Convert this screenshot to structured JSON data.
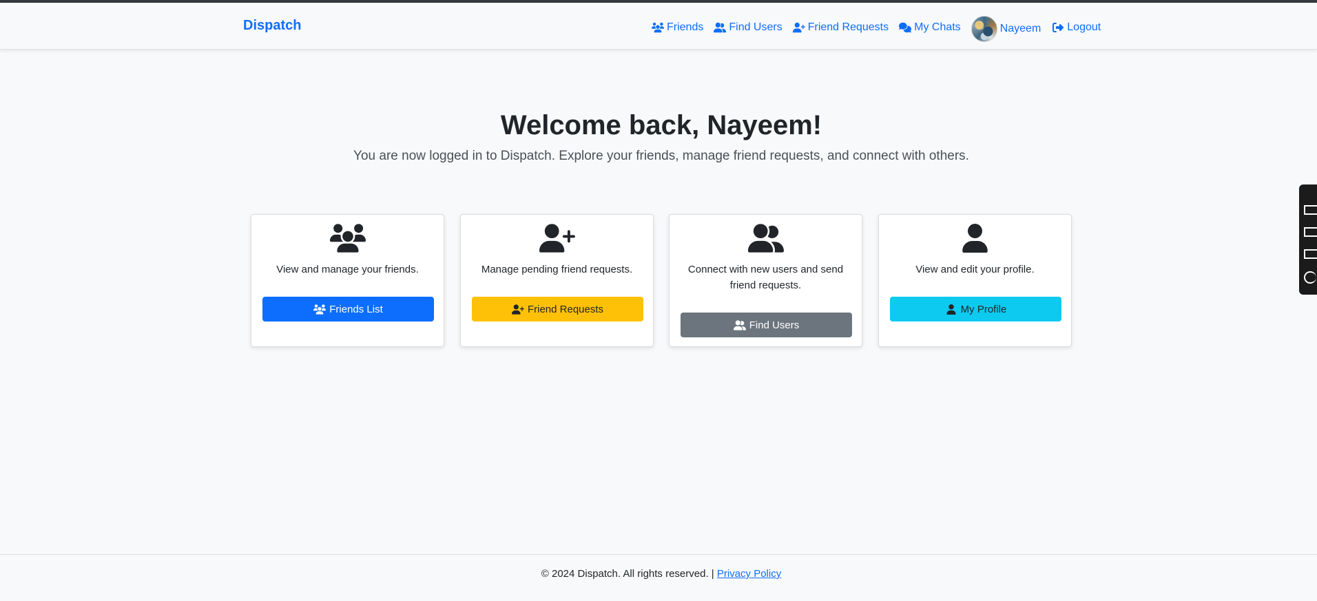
{
  "nav": {
    "brand": "Dispatch",
    "links": [
      {
        "label": "Friends",
        "icon": "users-icon"
      },
      {
        "label": "Find Users",
        "icon": "user-group-icon"
      },
      {
        "label": "Friend Requests",
        "icon": "user-plus-icon"
      },
      {
        "label": "My Chats",
        "icon": "comments-icon"
      }
    ],
    "user_name": "Nayeem",
    "logout": "Logout"
  },
  "hero": {
    "title": "Welcome back, Nayeem!",
    "subtitle": "You are now logged in to Dispatch. Explore your friends, manage friend requests, and connect with others."
  },
  "cards": [
    {
      "icon": "users-icon",
      "text": "View and manage your friends.",
      "button": "Friends List",
      "color": "#0d6efd"
    },
    {
      "icon": "user-plus-icon",
      "text": "Manage pending friend requests.",
      "button": "Friend Requests",
      "color": "#ffc107"
    },
    {
      "icon": "user-group-icon",
      "text": "Connect with new users and send friend requests.",
      "button": "Find Users",
      "color": "#6c757d"
    },
    {
      "icon": "user-icon",
      "text": "View and edit your profile.",
      "button": "My Profile",
      "color": "#0dcaf0"
    }
  ],
  "footer": {
    "text": "© 2024 Dispatch. All rights reserved. |",
    "link": "Privacy Policy"
  }
}
